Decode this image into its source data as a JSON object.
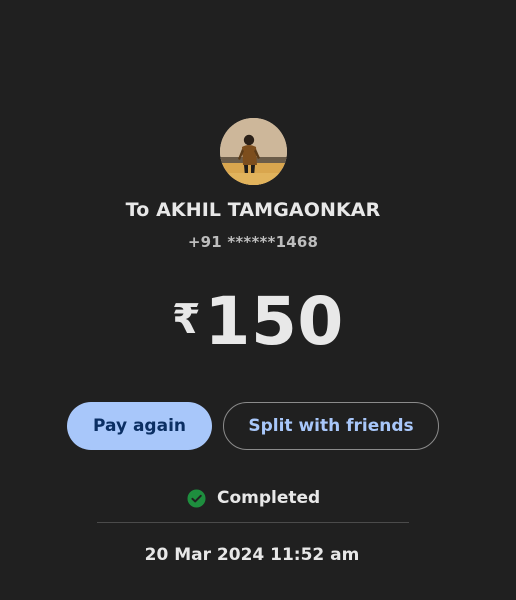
{
  "payee": {
    "avatar_icon": "person-photo-icon",
    "name": "To AKHIL TAMGAONKAR",
    "phone": "+91 ******1468"
  },
  "payment": {
    "currency_symbol": "₹",
    "amount": "150"
  },
  "actions": {
    "pay_again_label": "Pay again",
    "split_label": "Split with friends"
  },
  "status": {
    "icon": "check-circle-icon",
    "text": "Completed",
    "color": "#1e8e3e"
  },
  "transaction": {
    "timestamp": "20 Mar 2024 11:52 am"
  },
  "theme": {
    "background": "#202020",
    "primary_button": "#a8c7fa",
    "primary_button_text": "#0b2f63",
    "outline_button_text": "#a8c7fa"
  }
}
